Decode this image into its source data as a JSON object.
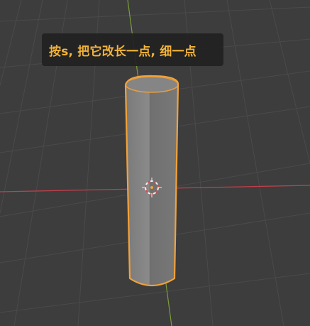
{
  "viewport": {
    "background_color": "#3d3d3d",
    "grid_color": "#4a4a4a",
    "x_axis_color": "#c0404d",
    "y_axis_color": "#7a9e3a"
  },
  "object": {
    "shape": "cylinder",
    "body_color": "#7f7f7f",
    "selection_outline_color": "#f2a23a"
  },
  "cursor_3d": {
    "icon": "3d-cursor-icon",
    "ring_color_a": "#e04848",
    "ring_color_b": "#f0f0f0"
  },
  "caption": {
    "text": "按s, 把它改长一点, 细一点",
    "text_color": "#f2b33a"
  }
}
